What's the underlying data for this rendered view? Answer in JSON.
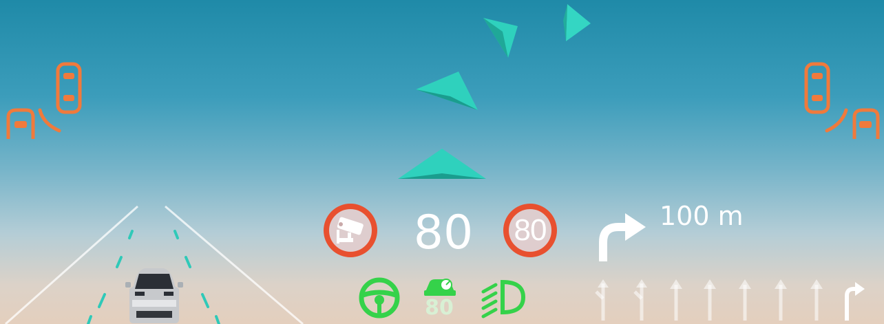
{
  "speed_display": {
    "current_speed": "80"
  },
  "speed_limit_sign": {
    "value": "80"
  },
  "speed_camera_sign": {
    "icon": "speed-camera-icon"
  },
  "navigation": {
    "maneuver_icon": "turn-right-arrow-icon",
    "distance": "100 m"
  },
  "status_indicators": {
    "steering_assist_icon": "steering-wheel-icon",
    "speed_limiter_icon": "speed-limiter-icon",
    "speed_limiter_value": "80",
    "headlight_icon": "low-beam-headlight-icon"
  },
  "lane_guidance": {
    "lanes": [
      "straight-left",
      "straight-left",
      "straight",
      "straight",
      "straight",
      "straight",
      "straight",
      "right"
    ],
    "active_lane_index": 7
  },
  "blind_spot_warnings": {
    "left": "vehicle-warning",
    "right": "vehicle-warning"
  },
  "colors": {
    "warning_orange": "#f07a3c",
    "sign_red": "#e8502f",
    "assist_green": "#35d24a",
    "ar_arrow_teal": "#2fd1bd",
    "text_white": "#ffffff"
  }
}
